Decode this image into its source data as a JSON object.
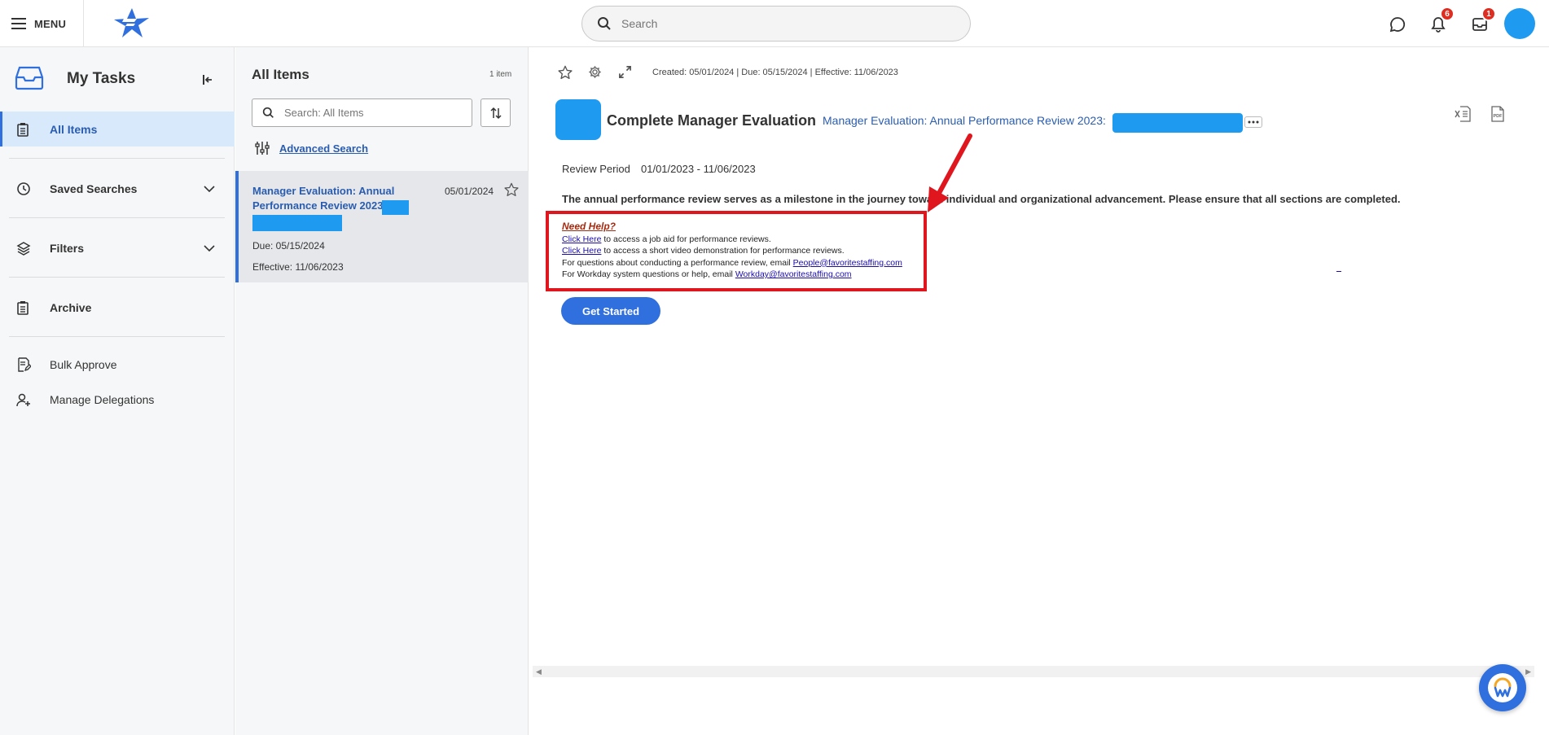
{
  "topbar": {
    "menu_label": "MENU",
    "search_placeholder": "Search",
    "notifications_count": "6",
    "inbox_count": "1"
  },
  "sidebar": {
    "title": "My Tasks",
    "items": [
      {
        "label": "All Items"
      },
      {
        "label": "Saved Searches"
      },
      {
        "label": "Filters"
      },
      {
        "label": "Archive"
      },
      {
        "label": "Bulk Approve"
      },
      {
        "label": "Manage Delegations"
      }
    ]
  },
  "list": {
    "title": "All Items",
    "count": "1 item",
    "search_placeholder": "Search: All Items",
    "advanced_search": "Advanced Search",
    "task": {
      "title": "Manager Evaluation: Annual Performance Review 2023:",
      "date": "05/01/2024",
      "due": "Due: 05/15/2024",
      "effective": "Effective: 11/06/2023"
    }
  },
  "main": {
    "meta": "Created: 05/01/2024 | Due: 05/15/2024 | Effective: 11/06/2023",
    "heading": "Complete Manager Evaluation",
    "subtitle": "Manager Evaluation: Annual Performance Review 2023:",
    "review_period_label": "Review Period",
    "review_period_value": "01/01/2023 - 11/06/2023",
    "intro": "The annual performance review serves as a milestone in the journey toward individual and organizational advancement. Please ensure that all sections are completed.",
    "help": {
      "title": "Need Help?",
      "line1_link": "Click Here",
      "line1_text": " to access a job aid for performance reviews.",
      "line2_link": "Click Here",
      "line2_text": " to access a short video demonstration for performance reviews.",
      "line3_text": "For questions about conducting a performance review, email ",
      "line3_link": "People@favoritestaffing.com",
      "line4_text": "For Workday system questions or help, email ",
      "line4_link": "Workday@favoritestaffing.com "
    },
    "get_started": "Get Started"
  },
  "colors": {
    "accent": "#2f6fde",
    "redaction": "#1e9bf0",
    "highlight_box": "#e0161f",
    "badge": "#de2e21"
  }
}
